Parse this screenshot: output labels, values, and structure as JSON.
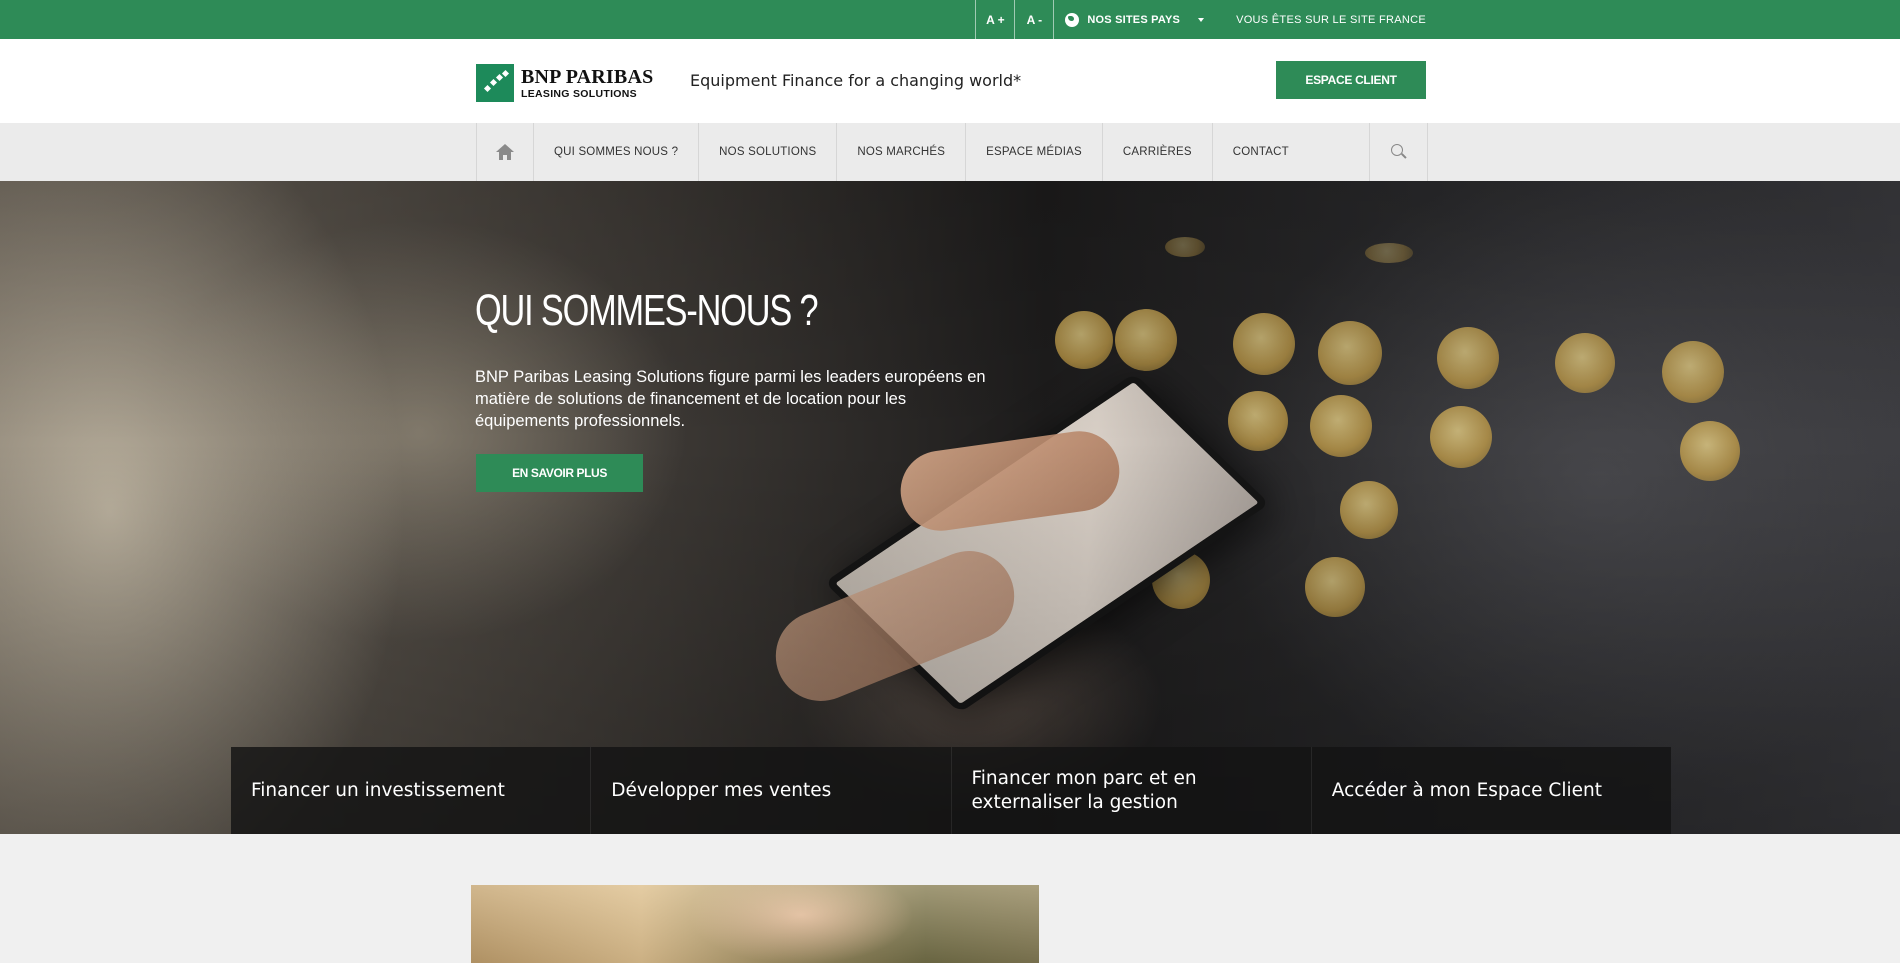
{
  "topbar": {
    "font_increase": "A +",
    "font_decrease": "A -",
    "country_sites": "NOS SITES PAYS",
    "current_site": "VOUS ÊTES SUR LE SITE FRANCE"
  },
  "header": {
    "logo_name": "BNP PARIBAS",
    "logo_sub": "LEASING SOLUTIONS",
    "tagline": "Equipment Finance for a changing world*",
    "client_button": "ESPACE CLIENT"
  },
  "nav": {
    "items": [
      {
        "label": "QUI SOMMES NOUS ?"
      },
      {
        "label": "NOS SOLUTIONS"
      },
      {
        "label": "NOS MARCHÉS"
      },
      {
        "label": "ESPACE MÉDIAS"
      },
      {
        "label": "CARRIÈRES"
      },
      {
        "label": "CONTACT"
      }
    ]
  },
  "hero": {
    "title": "QUI SOMMES-NOUS ?",
    "text": "BNP Paribas Leasing Solutions figure parmi les leaders européens en matière de solutions de financement et de location pour les équipements professionnels.",
    "button": "EN SAVOIR PLUS"
  },
  "quick_links": [
    {
      "label": "Financer un investissement"
    },
    {
      "label": "Développer mes ventes"
    },
    {
      "label": "Financer mon parc et en externaliser la gestion"
    },
    {
      "label": "Accéder à mon Espace Client"
    }
  ],
  "colors": {
    "brand_green": "#2e8b57",
    "nav_bg": "#ebebeb",
    "page_bg": "#f0f0f0"
  },
  "icons": {
    "globe": "globe-icon",
    "home": "home-icon",
    "search": "search-icon",
    "caret": "chevron-down-icon"
  }
}
